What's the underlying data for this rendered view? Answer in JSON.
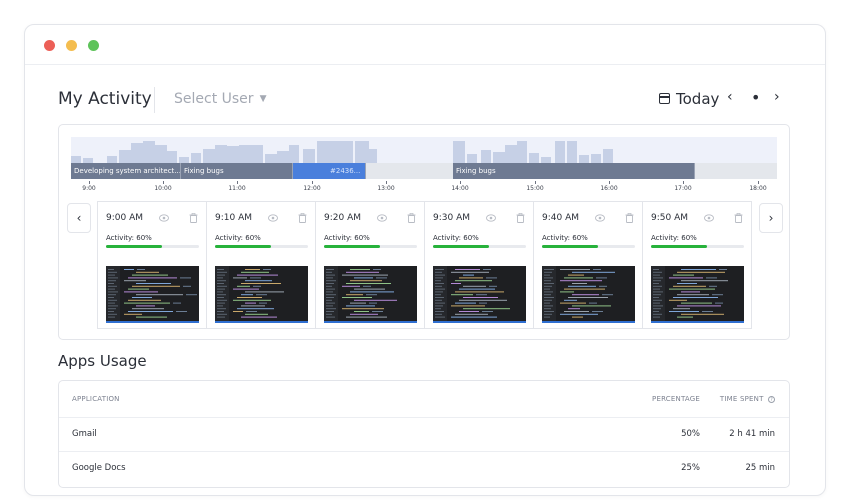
{
  "header": {
    "title": "My Activity",
    "select_user": "Select User",
    "date_label": "Today",
    "prev": "‹",
    "dot": "•",
    "next": "›"
  },
  "colors": {
    "segment": "#6e7a92",
    "segment_highlight": "#4a7fdc",
    "histogram": "#c6d0e6",
    "progress": "#27b23b"
  },
  "timeline": {
    "segments": [
      {
        "label": "Developing system architect...",
        "highlight": false
      },
      {
        "label": "Fixing bugs",
        "highlight": false
      },
      {
        "label": "#2436...",
        "highlight": true
      },
      {
        "label": "Fixing bugs",
        "highlight": false
      }
    ],
    "ticks": [
      "9:00",
      "10:00",
      "11:00",
      "12:00",
      "13:00",
      "14:00",
      "15:00",
      "16:00",
      "17:00",
      "18:00"
    ]
  },
  "cards": [
    {
      "time": "9:00 AM",
      "activity": "Activity: 60%",
      "progress": 0.6
    },
    {
      "time": "9:10 AM",
      "activity": "Activity: 60%",
      "progress": 0.6
    },
    {
      "time": "9:20 AM",
      "activity": "Activity: 60%",
      "progress": 0.6
    },
    {
      "time": "9:30 AM",
      "activity": "Activity: 60%",
      "progress": 0.6
    },
    {
      "time": "9:40 AM",
      "activity": "Activity: 60%",
      "progress": 0.6
    },
    {
      "time": "9:50 AM",
      "activity": "Activity: 60%",
      "progress": 0.6
    }
  ],
  "apps": {
    "title": "Apps Usage",
    "columns": {
      "application": "APPLICATION",
      "percentage": "PERCENTAGE",
      "time_spent": "TIME SPENT"
    },
    "rows": [
      {
        "application": "Gmail",
        "percentage": "50%",
        "time_spent": "2 h 41 min"
      },
      {
        "application": "Google Docs",
        "percentage": "25%",
        "time_spent": "25 min"
      }
    ]
  }
}
